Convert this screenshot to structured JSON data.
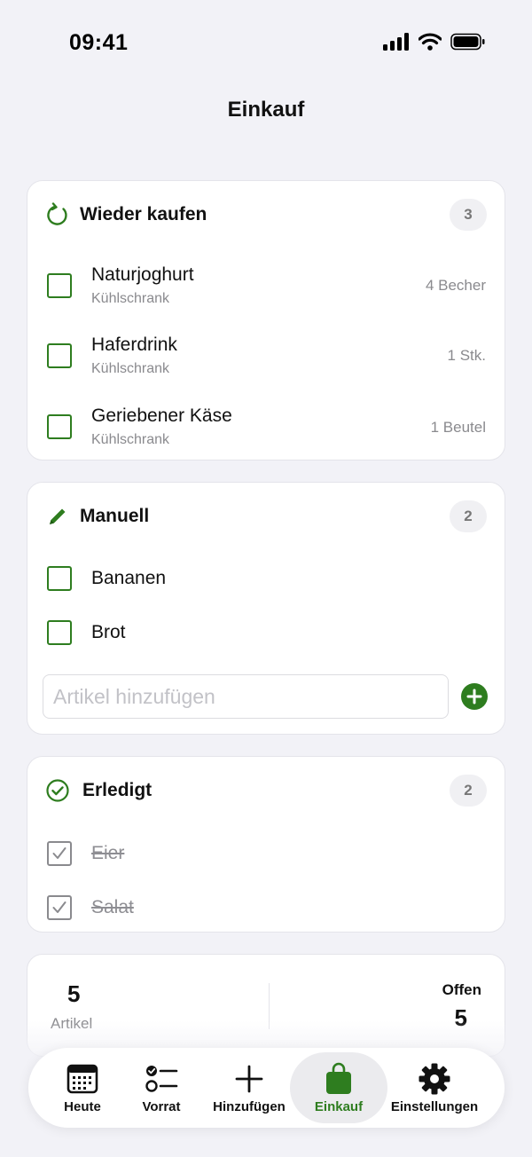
{
  "status_bar": {
    "time": "09:41"
  },
  "page": {
    "title": "Einkauf"
  },
  "colors": {
    "accent": "#2e7d1f",
    "background": "#f2f2f7",
    "muted": "#8a8a8e"
  },
  "sections": {
    "rebuy": {
      "title": "Wieder kaufen",
      "icon": "refresh-icon",
      "count": "3",
      "items": [
        {
          "name": "Naturjoghurt",
          "location": "Kühlschrank",
          "quantity": "4 Becher"
        },
        {
          "name": "Haferdrink",
          "location": "Kühlschrank",
          "quantity": "1 Stk."
        },
        {
          "name": "Geriebener Käse",
          "location": "Kühlschrank",
          "quantity": "1 Beutel"
        }
      ]
    },
    "manual": {
      "title": "Manuell",
      "icon": "pencil-icon",
      "count": "2",
      "items": [
        {
          "name": "Bananen"
        },
        {
          "name": "Brot"
        }
      ],
      "add_placeholder": "Artikel hinzufügen"
    },
    "done": {
      "title": "Erledigt",
      "icon": "check-circle-icon",
      "count": "2",
      "items": [
        {
          "name": "Eier"
        },
        {
          "name": "Salat"
        }
      ]
    }
  },
  "summary": {
    "total_value": "5",
    "total_label": "Artikel",
    "open_label": "Offen",
    "open_value": "5"
  },
  "tab_bar": {
    "active": "Einkauf",
    "tabs": [
      {
        "label": "Heute",
        "icon": "calendar-icon"
      },
      {
        "label": "Vorrat",
        "icon": "checklist-icon"
      },
      {
        "label": "Hinzufügen",
        "icon": "plus-icon"
      },
      {
        "label": "Einkauf",
        "icon": "shopping-bag-icon"
      },
      {
        "label": "Einstellungen",
        "icon": "gear-icon"
      }
    ]
  }
}
